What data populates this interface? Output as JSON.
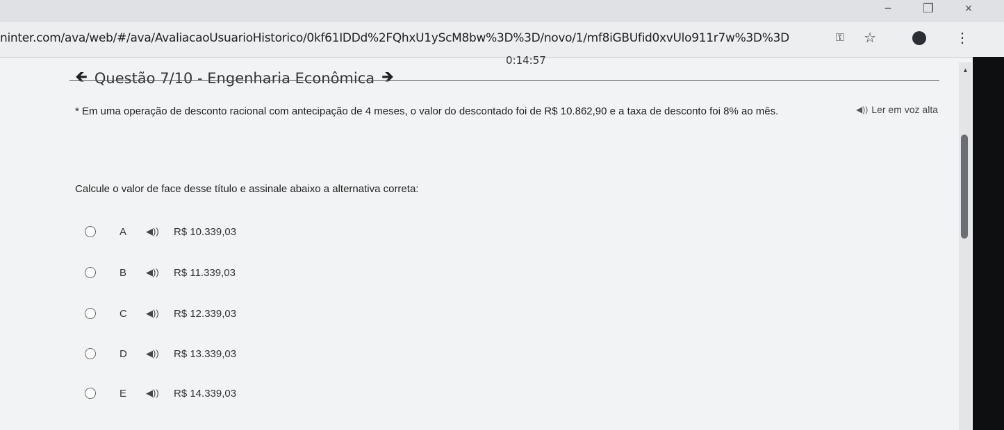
{
  "browser": {
    "url": "ninter.com/ava/web/#/ava/AvaliacaoUsuarioHistorico/0kf61IDDd%2FQhxU1yScM8bw%3D%3D/novo/1/mf8iGBUfid0xvUlo911r7w%3D%3D",
    "window_controls": {
      "minimize": "−",
      "restore": "❐",
      "close": "×"
    },
    "icons": {
      "key": "key-icon",
      "star": "star-icon",
      "menu": "more-vert-icon"
    }
  },
  "timer": "0:14:57",
  "header": {
    "title": "Questão 7/10 - Engenharia Econômica",
    "prev_icon": "arrow-left-icon",
    "next_icon": "arrow-right-icon"
  },
  "read_aloud": {
    "label": "Ler em voz alta",
    "icon": "speaker-icon"
  },
  "question": {
    "text": "* Em uma operação de desconto racional com antecipação de 4 meses, o valor do descontado foi de R$ 10.862,90 e a taxa de desconto foi 8% ao mês.",
    "instruction": "Calcule o valor de face desse título e assinale abaixo a alternativa correta:"
  },
  "options": [
    {
      "letter": "A",
      "value": "R$ 10.339,03"
    },
    {
      "letter": "B",
      "value": "R$ 11.339,03"
    },
    {
      "letter": "C",
      "value": "R$ 12.339,03"
    },
    {
      "letter": "D",
      "value": "R$ 13.339,03"
    },
    {
      "letter": "E",
      "value": "R$ 14.339,03"
    }
  ],
  "colors": {
    "page_bg": "#f2f3f4",
    "chrome_bg": "#dfe1e4",
    "text": "#222222"
  }
}
